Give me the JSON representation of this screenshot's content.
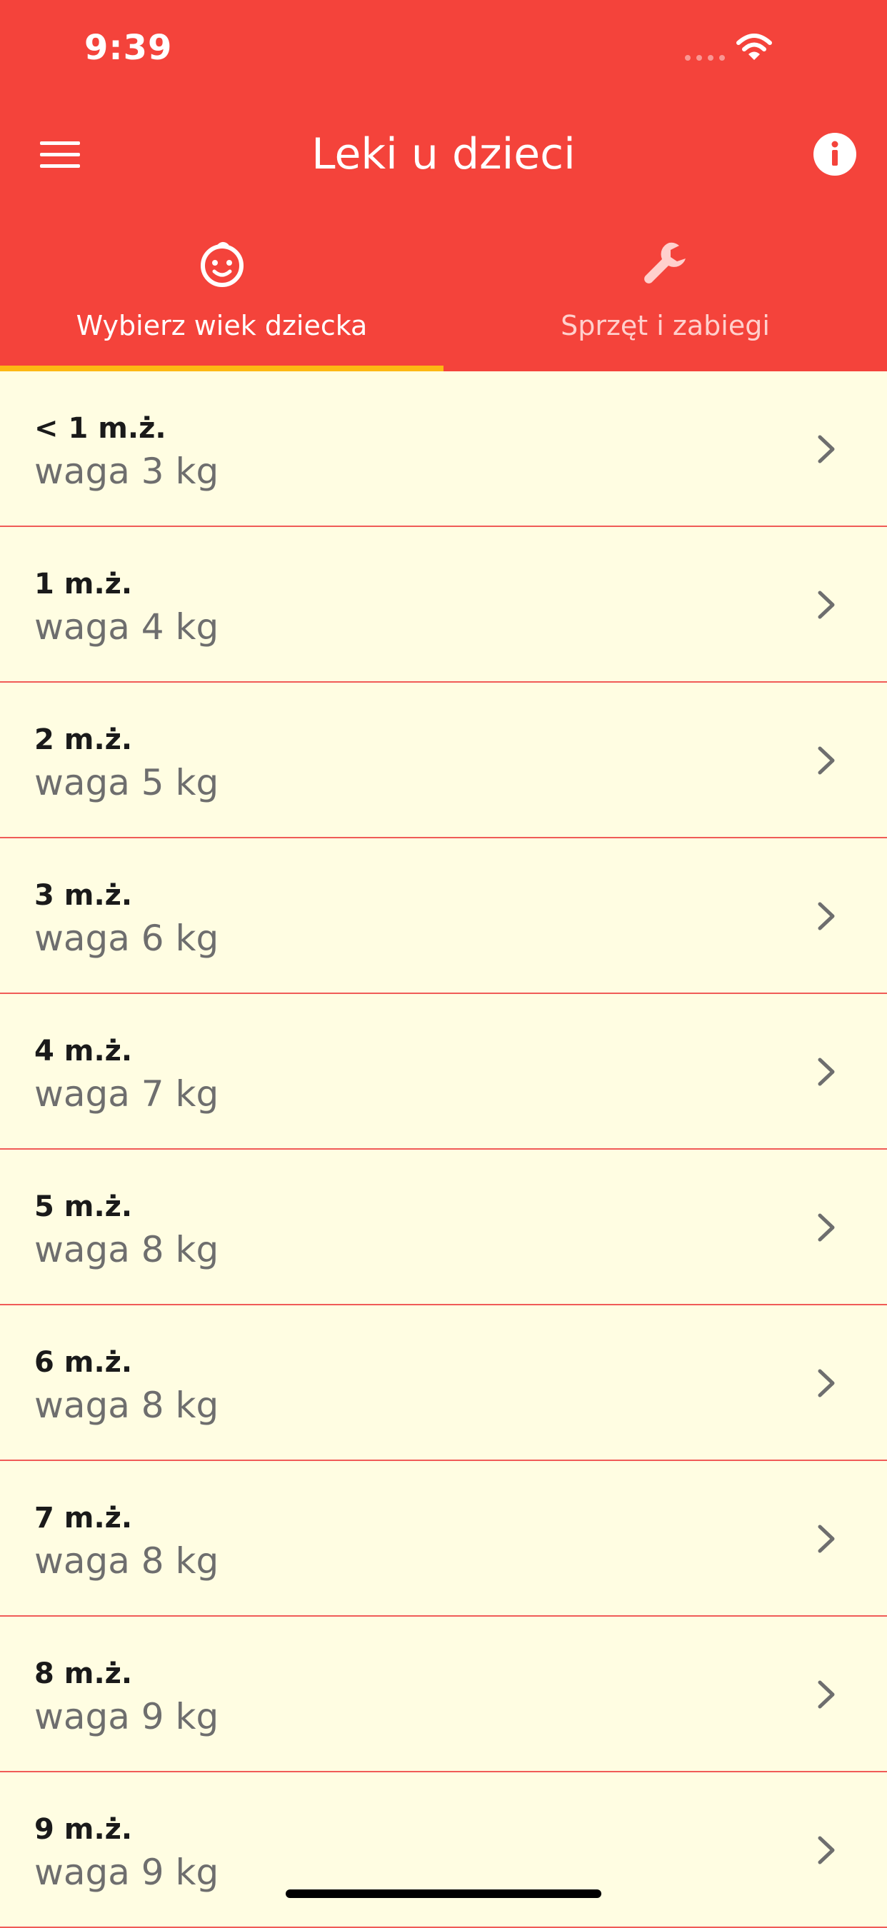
{
  "status_bar": {
    "time": "9:39"
  },
  "app_bar": {
    "title": "Leki u dzieci",
    "background_color": "#F4433B",
    "menu_icon": "hamburger-menu-icon",
    "info_icon": "info-icon"
  },
  "tabs": [
    {
      "label": "Wybierz wiek dziecka",
      "icon": "baby-face-icon",
      "selected": true
    },
    {
      "label": "Sprzęt i zabiegi",
      "icon": "wrench-icon",
      "selected": false
    }
  ],
  "tab_indicator_color": "#FDB813",
  "list_background_color": "#FFFDE2",
  "age_list": [
    {
      "age": "< 1 m.ż.",
      "weight": "waga 3 kg"
    },
    {
      "age": "1 m.ż.",
      "weight": "waga 4 kg"
    },
    {
      "age": "2 m.ż.",
      "weight": "waga 5 kg"
    },
    {
      "age": "3 m.ż.",
      "weight": "waga 6 kg"
    },
    {
      "age": "4 m.ż.",
      "weight": "waga 7 kg"
    },
    {
      "age": "5 m.ż.",
      "weight": "waga 8 kg"
    },
    {
      "age": "6 m.ż.",
      "weight": "waga 8 kg"
    },
    {
      "age": "7 m.ż.",
      "weight": "waga 8 kg"
    },
    {
      "age": "8 m.ż.",
      "weight": "waga 9 kg"
    },
    {
      "age": "9 m.ż.",
      "weight": "waga 9 kg"
    }
  ]
}
